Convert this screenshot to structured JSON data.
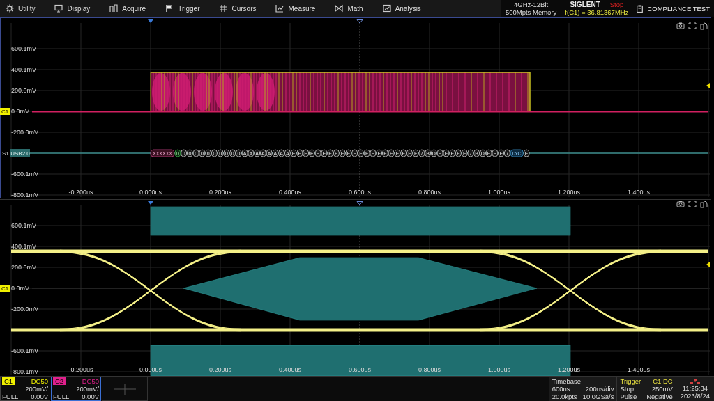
{
  "menu": [
    {
      "label": "Utility",
      "kind": "gear"
    },
    {
      "label": "Display",
      "kind": "monitor"
    },
    {
      "label": "Acquire",
      "kind": "pulse"
    },
    {
      "label": "Trigger",
      "kind": "flag"
    },
    {
      "label": "Cursors",
      "kind": "hash"
    },
    {
      "label": "Measure",
      "kind": "slope"
    },
    {
      "label": "Math",
      "kind": "bowtie"
    },
    {
      "label": "Analysis",
      "kind": "frame"
    }
  ],
  "instrument": {
    "spec": "4GHz-12Bit",
    "memory": "500Mpts Memory",
    "brand": "SIGLENT",
    "run_state": "Stop",
    "frequency": "f(C1) = 36.81367MHz",
    "compliance": "COMPLIANCE TEST"
  },
  "panels": [
    {
      "kind": "serial",
      "y_labels_top": [
        "600.1mV",
        "400.1mV",
        "200.0mV",
        "0.0mV",
        "-200.0mV"
      ],
      "y_labels_bottom": [
        "-600.1mV",
        "-800.1mV"
      ],
      "x_labels": [
        "-0.200us",
        "0.000us",
        "0.200us",
        "0.400us",
        "0.600us",
        "0.800us",
        "1.000us",
        "1.200us",
        "1.400us"
      ],
      "channel_tag": "C1",
      "serial_label": "S1",
      "serial_tag": "USB2.0",
      "decode": [
        {
          "text": "XXXXXX",
          "kind": "sync"
        },
        {
          "text": "0",
          "kind": "pid"
        },
        {
          "text": "0",
          "kind": "data"
        },
        {
          "text": "0",
          "kind": "data"
        },
        {
          "text": "0",
          "kind": "data"
        },
        {
          "text": "0",
          "kind": "data"
        },
        {
          "text": "0",
          "kind": "data"
        },
        {
          "text": "0",
          "kind": "data"
        },
        {
          "text": "0",
          "kind": "data"
        },
        {
          "text": "0",
          "kind": "data"
        },
        {
          "text": "0",
          "kind": "data"
        },
        {
          "text": "0",
          "kind": "data"
        },
        {
          "text": "A",
          "kind": "data"
        },
        {
          "text": "A",
          "kind": "data"
        },
        {
          "text": "A",
          "kind": "data"
        },
        {
          "text": "A",
          "kind": "data"
        },
        {
          "text": "A",
          "kind": "data"
        },
        {
          "text": "A",
          "kind": "data"
        },
        {
          "text": "A",
          "kind": "data"
        },
        {
          "text": "A",
          "kind": "data"
        },
        {
          "text": "E",
          "kind": "data"
        },
        {
          "text": "E",
          "kind": "data"
        },
        {
          "text": "E",
          "kind": "data"
        },
        {
          "text": "E",
          "kind": "data"
        },
        {
          "text": "E",
          "kind": "data"
        },
        {
          "text": "E",
          "kind": "data"
        },
        {
          "text": "E",
          "kind": "data"
        },
        {
          "text": "E",
          "kind": "data"
        },
        {
          "text": "E",
          "kind": "data"
        },
        {
          "text": "F",
          "kind": "data"
        },
        {
          "text": "F",
          "kind": "data"
        },
        {
          "text": "F",
          "kind": "data"
        },
        {
          "text": "F",
          "kind": "data"
        },
        {
          "text": "F",
          "kind": "data"
        },
        {
          "text": "F",
          "kind": "data"
        },
        {
          "text": "F",
          "kind": "data"
        },
        {
          "text": "F",
          "kind": "data"
        },
        {
          "text": "F",
          "kind": "data"
        },
        {
          "text": "F",
          "kind": "data"
        },
        {
          "text": "F",
          "kind": "data"
        },
        {
          "text": "F",
          "kind": "data"
        },
        {
          "text": "7",
          "kind": "data"
        },
        {
          "text": "B",
          "kind": "data"
        },
        {
          "text": "D",
          "kind": "data"
        },
        {
          "text": "E",
          "kind": "data"
        },
        {
          "text": "F",
          "kind": "data"
        },
        {
          "text": "F",
          "kind": "data"
        },
        {
          "text": "F",
          "kind": "data"
        },
        {
          "text": "F",
          "kind": "data"
        },
        {
          "text": "7",
          "kind": "data"
        },
        {
          "text": "B",
          "kind": "data"
        },
        {
          "text": "D",
          "kind": "data"
        },
        {
          "text": "E",
          "kind": "data"
        },
        {
          "text": "F",
          "kind": "data"
        },
        {
          "text": "F",
          "kind": "data"
        },
        {
          "text": "7",
          "kind": "data"
        },
        {
          "text": "0xC",
          "kind": "crc"
        },
        {
          "text": "E",
          "kind": "eop"
        }
      ]
    },
    {
      "kind": "eye",
      "y_labels_top": [
        "600.1mV",
        "400.1mV",
        "200.0mV",
        "0.0mV",
        "-200.0mV"
      ],
      "y_labels_bottom": [
        "-600.1mV",
        "-800.1mV"
      ],
      "x_labels": [
        "-0.200us",
        "0.000us",
        "0.200us",
        "0.400us",
        "0.600us",
        "0.800us",
        "1.000us",
        "1.200us",
        "1.400us"
      ],
      "channel_tag": "C1"
    }
  ],
  "channels": [
    {
      "name": "C1",
      "coupling": "DC50",
      "scale": "200mV/",
      "bandwidth": "FULL",
      "offset": "0.00V",
      "selected": false,
      "color": "#f0f000"
    },
    {
      "name": "C2",
      "coupling": "DC50",
      "scale": "200mV/",
      "bandwidth": "FULL",
      "offset": "0.00V",
      "selected": true,
      "color": "#e0208c"
    }
  ],
  "timebase": {
    "title": "Timebase",
    "delay": "600ns",
    "scale": "200ns/div",
    "points": "20.0kpts",
    "rate": "10.0GSa/s"
  },
  "trigger": {
    "title": "Trigger",
    "source": "C1 DC",
    "state": "Stop",
    "threshold": "250mV",
    "type": "Pulse",
    "slope": "Negative"
  },
  "clock": {
    "time": "11:25:34",
    "date": "2023/8/24"
  }
}
